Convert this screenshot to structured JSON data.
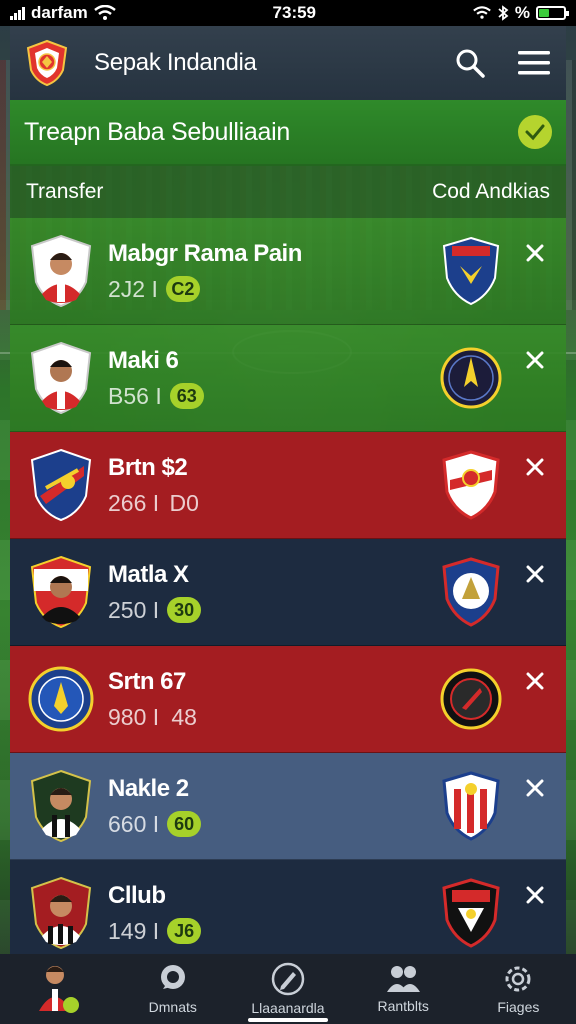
{
  "status_bar": {
    "carrier": "darfam",
    "time": "73:59",
    "battery_label": "%"
  },
  "app_bar": {
    "title": "Sepak Indandia"
  },
  "banner": {
    "title": "Treapn Baba Sebulliaain"
  },
  "section": {
    "left": "Transfer",
    "right": "Cod Andkias"
  },
  "rows": [
    {
      "name": "Mabgr Rama Pain",
      "value": "2J2 I",
      "badge": "C2",
      "theme": "green"
    },
    {
      "name": "Maki 6",
      "value": "B56 I",
      "badge": "63",
      "theme": "green"
    },
    {
      "name": "Brtn $2",
      "value": "266 I",
      "badge": "D0",
      "theme": "red"
    },
    {
      "name": "Matla X",
      "value": "250 I",
      "badge": "30",
      "theme": "navy"
    },
    {
      "name": "Srtn 67",
      "value": "980 I",
      "badge": "48",
      "theme": "red"
    },
    {
      "name": "Nakle 2",
      "value": "660 I",
      "badge": "60",
      "theme": "slate"
    },
    {
      "name": "Cllub",
      "value": "149 I",
      "badge": "J6",
      "theme": "navy"
    }
  ],
  "bottom_nav": [
    {
      "label": "",
      "icon": "profile-avatar"
    },
    {
      "label": "Dmnats",
      "icon": "chat-icon"
    },
    {
      "label": "Llaaanardla",
      "icon": "edit-icon"
    },
    {
      "label": "Rantblts",
      "icon": "people-icon"
    },
    {
      "label": "Fiages",
      "icon": "settings-icon"
    }
  ],
  "colors": {
    "accent": "#a6d12a",
    "red_row": "#a41d21",
    "navy_row": "#1d2b40",
    "slate_row": "#465d80",
    "green_row": "#2f8a2a"
  }
}
